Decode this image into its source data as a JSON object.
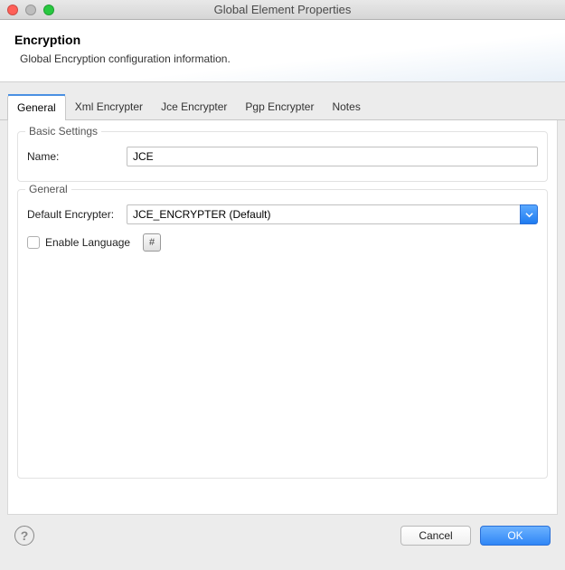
{
  "window": {
    "title": "Global Element Properties"
  },
  "header": {
    "title": "Encryption",
    "subtitle": "Global Encryption configuration information."
  },
  "tabs": [
    {
      "label": "General",
      "active": true
    },
    {
      "label": "Xml Encrypter",
      "active": false
    },
    {
      "label": "Jce Encrypter",
      "active": false
    },
    {
      "label": "Pgp Encrypter",
      "active": false
    },
    {
      "label": "Notes",
      "active": false
    }
  ],
  "sections": {
    "basic": {
      "legend": "Basic Settings",
      "name_label": "Name:",
      "name_value": "JCE"
    },
    "general": {
      "legend": "General",
      "default_encrypter_label": "Default Encrypter:",
      "default_encrypter_value": "JCE_ENCRYPTER (Default)",
      "enable_language_label": "Enable Language",
      "hash_label": "#"
    }
  },
  "footer": {
    "help": "?",
    "cancel": "Cancel",
    "ok": "OK"
  }
}
